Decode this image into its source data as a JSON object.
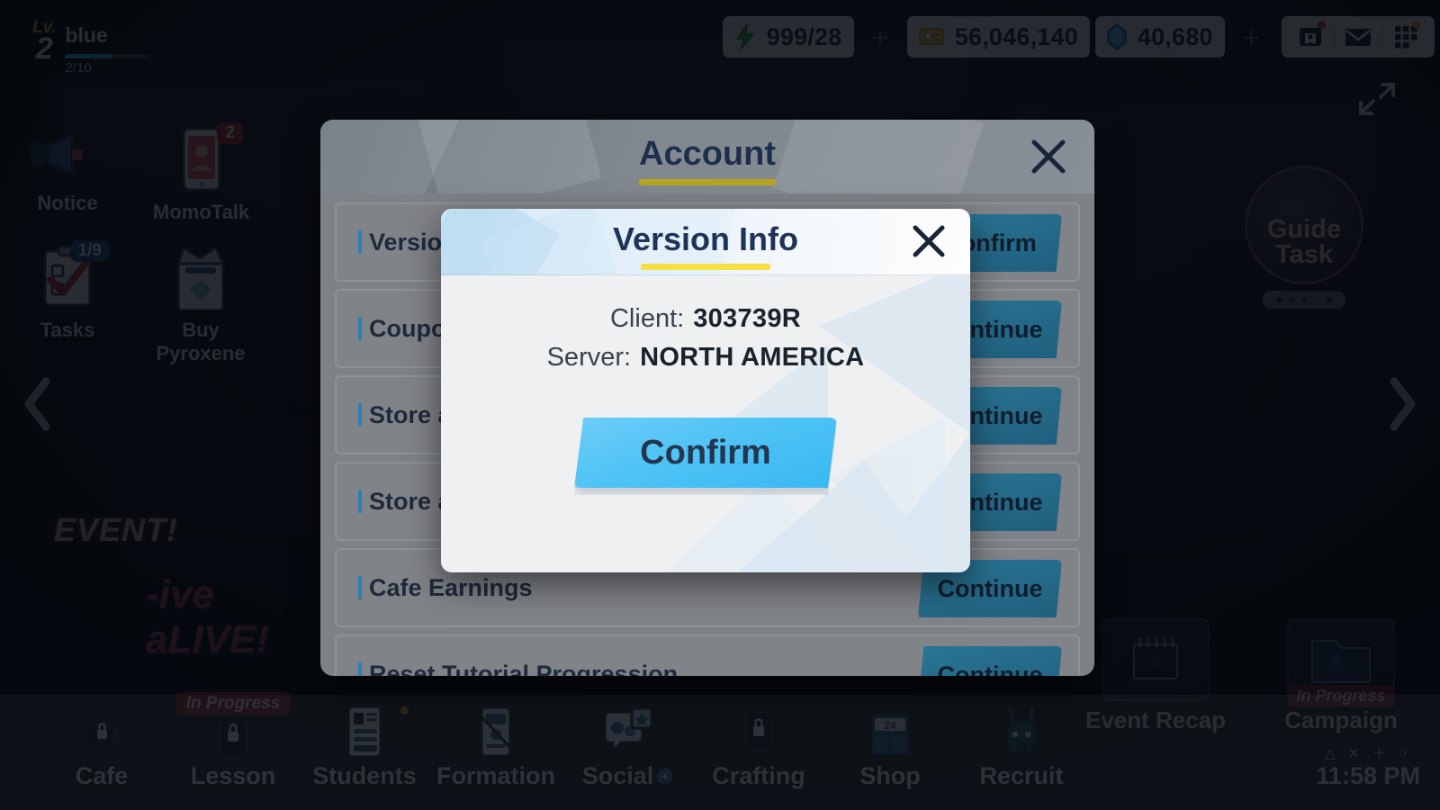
{
  "hud": {
    "level_word": "Lv.",
    "level_num": "2",
    "nickname": "blue",
    "xp_text": "2/10",
    "currencies": [
      {
        "icon": "ap-bolt-icon",
        "value": "999/28",
        "has_plus": true
      },
      {
        "icon": "credit-icon",
        "value": "56,046,140",
        "has_plus": false
      },
      {
        "icon": "pyroxene-icon",
        "value": "40,680",
        "has_plus": true
      }
    ],
    "icons": [
      {
        "name": "profile-card-icon",
        "badge": "red"
      },
      {
        "name": "mail-icon",
        "badge": "red"
      },
      {
        "name": "menu-grid-icon",
        "badge": "orange"
      }
    ]
  },
  "side_left": {
    "items": [
      {
        "label": "Notice",
        "icon": "megaphone-icon",
        "badge": ""
      },
      {
        "label": "MomoTalk",
        "icon": "phone-icon",
        "badge": "2"
      },
      {
        "label": "Tasks",
        "icon": "checklist-icon",
        "badge": "1/9"
      },
      {
        "label": "Buy Pyroxene",
        "icon": "gembag-icon",
        "badge": ""
      }
    ]
  },
  "guide_task": {
    "title_line1": "Guide",
    "title_line2": "Task",
    "dots": 5,
    "active_dot": 4
  },
  "event_banner": {
    "tag": "EVENT!",
    "logo_left": "-ive",
    "logo_right": "aLIVE!"
  },
  "right_shortcuts": [
    {
      "label": "Event Recap",
      "icon": "calendar-lock-icon",
      "badge": ""
    },
    {
      "label": "Campaign",
      "icon": "campaign-folder-icon",
      "badge": "In Progress"
    }
  ],
  "bottom_bar": {
    "items": [
      {
        "label": "Cafe",
        "icon": "cafe-cup-lock-icon",
        "badge": "",
        "plus": false,
        "dot": false
      },
      {
        "label": "Lesson",
        "icon": "lesson-lock-icon",
        "badge": "In Progress",
        "plus": false,
        "dot": false
      },
      {
        "label": "Students",
        "icon": "students-icon",
        "badge": "",
        "plus": false,
        "dot": true
      },
      {
        "label": "Formation",
        "icon": "formation-icon",
        "badge": "",
        "plus": false,
        "dot": false
      },
      {
        "label": "Social",
        "icon": "social-icon",
        "badge": "",
        "plus": true,
        "dot": false
      },
      {
        "label": "Crafting",
        "icon": "crafting-lock-icon",
        "badge": "",
        "plus": false,
        "dot": false
      },
      {
        "label": "Shop",
        "icon": "shop-icon",
        "badge": "",
        "plus": false,
        "dot": false
      },
      {
        "label": "Recruit",
        "icon": "recruit-icon",
        "badge": "",
        "plus": false,
        "dot": false
      }
    ],
    "clock_symbols": "△ ✕ ＋ ○",
    "clock_time": "11:58 PM"
  },
  "account_dialog": {
    "title": "Account",
    "close_icon": "close-icon",
    "rows": [
      {
        "label": "Version Info",
        "button": "Confirm"
      },
      {
        "label": "Coupon",
        "button": "Continue"
      },
      {
        "label": "Store account information",
        "button": "Continue"
      },
      {
        "label": "Store account information",
        "button": "Continue"
      },
      {
        "label": "Cafe Earnings",
        "button": "Continue"
      },
      {
        "label": "Reset Tutorial Progression",
        "button": "Continue"
      }
    ]
  },
  "version_info_modal": {
    "title": "Version Info",
    "close_icon": "close-icon",
    "fields": [
      {
        "key": "Client:",
        "value": "303739R"
      },
      {
        "key": "Server:",
        "value": "NORTH AMERICA"
      }
    ],
    "confirm_label": "Confirm"
  },
  "colors": {
    "accent_blue": "#4fc3f5",
    "title_navy": "#1f3358",
    "header_underline_yellow": "#f6e045",
    "account_underline": "#b8a421",
    "row_button_teal": "#2b7595",
    "badge_red": "#b22431",
    "inprogress_red": "#8e2233"
  }
}
